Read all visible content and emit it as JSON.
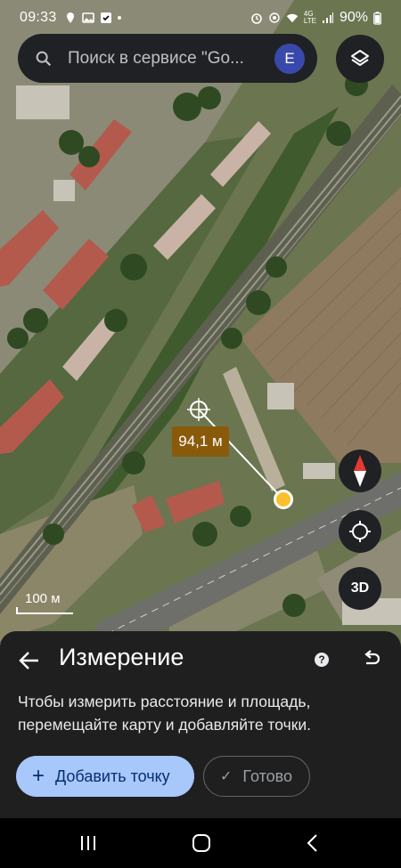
{
  "status_bar": {
    "time": "09:33",
    "battery_percent": "90%",
    "network_badge": "4G",
    "network_sub": "LTE"
  },
  "search": {
    "placeholder": "Поиск в сервисе \"Go...",
    "avatar_letter": "E",
    "icons": [
      "search-icon",
      "layers-icon"
    ]
  },
  "map": {
    "distance_label": "94,1 м",
    "scale_label": "100 м",
    "three_d_label": "3D",
    "icons": [
      "crosshair-icon",
      "compass-icon",
      "my-location-icon"
    ]
  },
  "measure_sheet": {
    "title": "Измерение",
    "help_label": "?",
    "instructions": "Чтобы измерить расстояние и площадь, перемещайте карту и добавляйте точки.",
    "add_point_label": "Добавить точку",
    "done_label": "Готово",
    "icons": [
      "back-arrow-icon",
      "help-icon",
      "undo-icon",
      "plus-icon",
      "check-icon"
    ]
  },
  "nav_bar": {
    "icons": [
      "recent-apps-icon",
      "home-icon",
      "back-icon"
    ]
  },
  "colors": {
    "sheet_bg": "#1f1f1f",
    "primary_button": "#a8c7fa",
    "distance_label_bg": "#8a5a0b",
    "point_marker": "#fbc02d",
    "avatar": "#3949ab"
  }
}
